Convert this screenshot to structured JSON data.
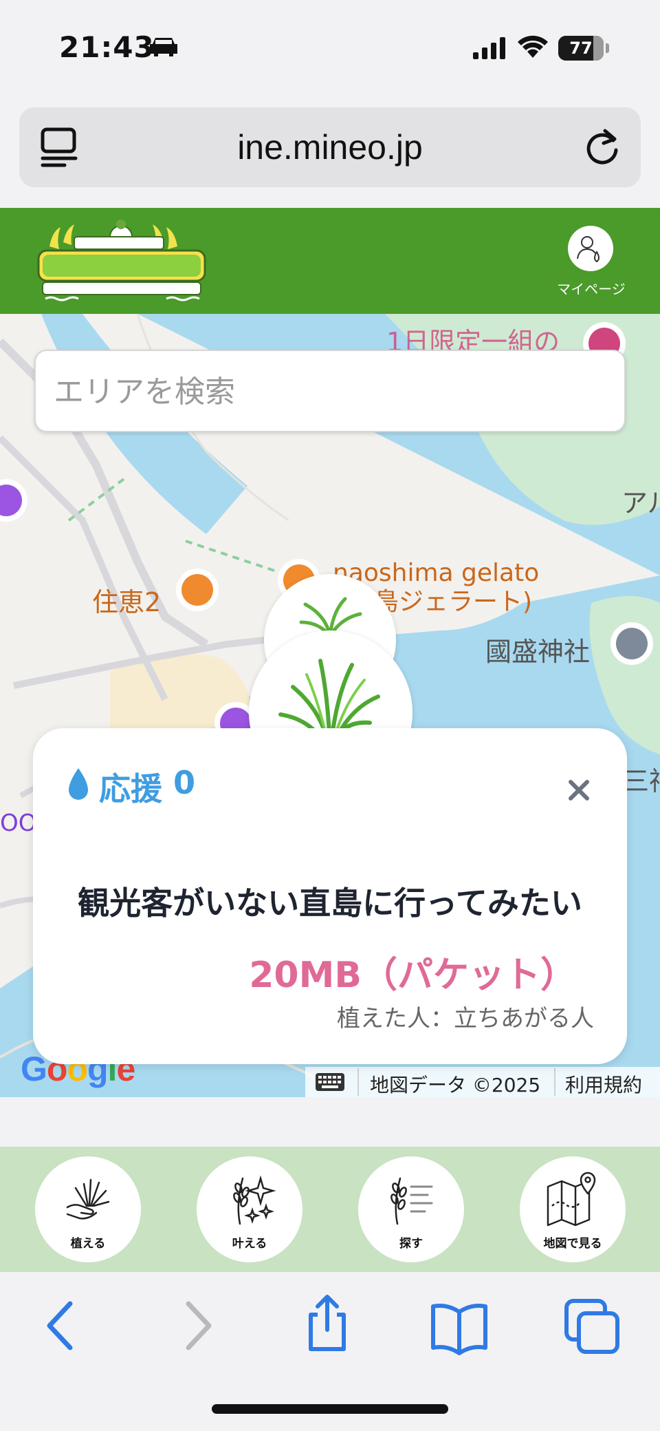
{
  "status": {
    "time": "21:43",
    "battery": "77",
    "battery_level": 0.77
  },
  "browser": {
    "url": "ine.mineo.jp"
  },
  "header": {
    "mypage_label": "マイページ"
  },
  "search": {
    "placeholder": "エリアを検索"
  },
  "map": {
    "labels": {
      "limited": "1日限定一組の",
      "sumie": "住恵2",
      "gelato_line1": "naoshima gelato",
      "gelato_line2": "島ジェラート)",
      "kokusei": "國盛神社",
      "a": "アル",
      "shin": "三神",
      "oo": "OO"
    },
    "google": "Google",
    "data_label": "地図データ ©2025",
    "terms_label": "利用規約"
  },
  "card": {
    "support_label": "応援",
    "support_count": "0",
    "title": "観光客がいない直島に行ってみたい",
    "reward": "20MB（パケット）",
    "planter": "植えた人：立ちあがる人"
  },
  "nav": [
    {
      "label": "植える",
      "icon": "plant-hand-icon"
    },
    {
      "label": "叶える",
      "icon": "rice-sparkle-icon"
    },
    {
      "label": "探す",
      "icon": "rice-list-icon"
    },
    {
      "label": "地図で見る",
      "icon": "map-pin-icon"
    }
  ],
  "colors": {
    "header_green": "#4a9b2a",
    "nav_bg": "#c8e2c2",
    "support_blue": "#3f9de0",
    "reward_pink": "#e06a97",
    "safari_blue": "#2f7ae5"
  }
}
